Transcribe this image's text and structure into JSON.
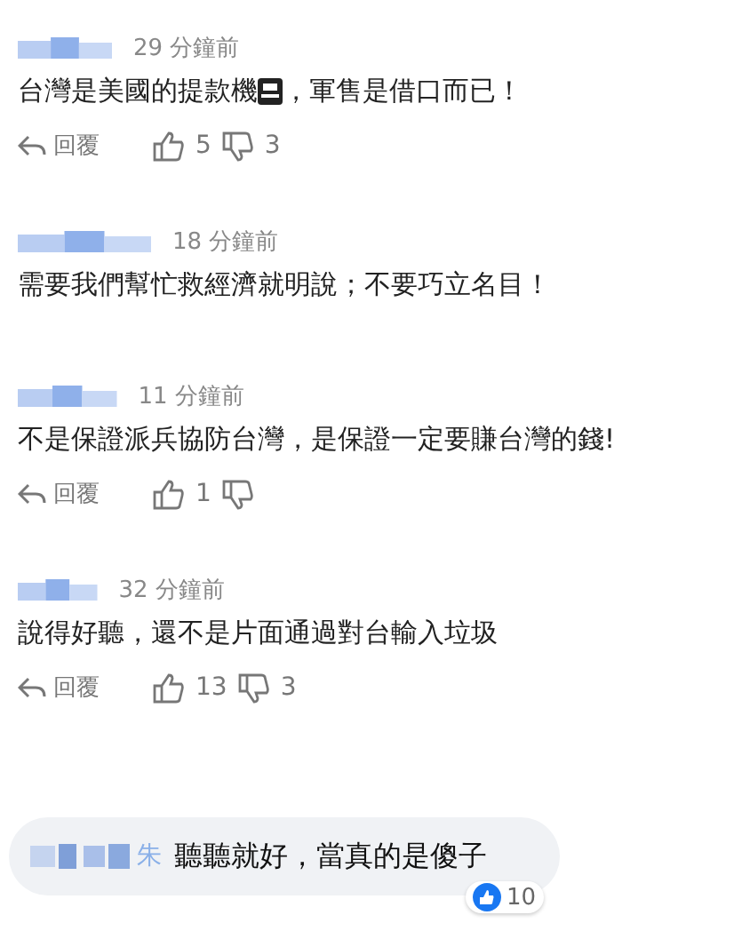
{
  "comments": [
    {
      "time": "29 分鐘前",
      "text": [
        "台灣是美國的提款機",
        "，軍售是借口而已！"
      ],
      "reply": "回覆",
      "likes": "5",
      "dislikes": "3"
    },
    {
      "time": "18 分鐘前",
      "text": [
        "需要我們幫忙救經濟就明說；不要巧立名目！"
      ]
    },
    {
      "time": "11 分鐘前",
      "text": [
        "不是保證派兵協防台灣，是保證一定要賺台灣的錢!"
      ],
      "reply": "回覆",
      "likes": "1"
    },
    {
      "time": "32 分鐘前",
      "text": [
        "說得好聽，還不是片面通過對台輸入垃圾"
      ],
      "reply": "回覆",
      "likes": "13",
      "dislikes": "3"
    }
  ],
  "bubble": {
    "name_tail": "朱",
    "text": "聽聽就好，當真的是傻子",
    "reactions": "10"
  }
}
